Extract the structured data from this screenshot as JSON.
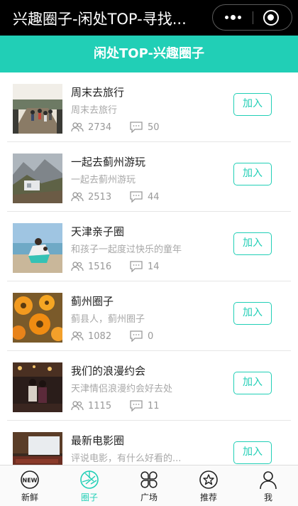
{
  "window": {
    "title": "兴趣圈子-闲处TOP-寻找..."
  },
  "header": {
    "title": "闲处TOP-兴趣圈子"
  },
  "colors": {
    "accent": "#21cfb6",
    "muted": "#a8a8a8"
  },
  "groups": [
    {
      "name": "周末去旅行",
      "desc": "周末去旅行",
      "members": "2734",
      "posts": "50",
      "join_label": "加入"
    },
    {
      "name": "一起去蓟州游玩",
      "desc": "一起去蓟州游玩",
      "members": "2513",
      "posts": "44",
      "join_label": "加入"
    },
    {
      "name": "天津亲子圈",
      "desc": "和孩子一起度过快乐的童年",
      "members": "1516",
      "posts": "14",
      "join_label": "加入"
    },
    {
      "name": "蓟州圈子",
      "desc": "蓟县人，蓟州圈子",
      "members": "1082",
      "posts": "0",
      "join_label": "加入"
    },
    {
      "name": "我们的浪漫约会",
      "desc": "天津情侣浪漫约会好去处",
      "members": "1115",
      "posts": "11",
      "join_label": "加入"
    },
    {
      "name": "最新电影圈",
      "desc": "评说电影，有什么好看的...",
      "members": "",
      "posts": "",
      "join_label": "加入"
    }
  ],
  "tabs": [
    {
      "label": "新鲜",
      "icon": "new-icon"
    },
    {
      "label": "圈子",
      "icon": "camera-aperture-icon",
      "active": true
    },
    {
      "label": "广场",
      "icon": "four-leaf-icon"
    },
    {
      "label": "推荐",
      "icon": "star-circle-icon"
    },
    {
      "label": "我",
      "icon": "person-icon"
    }
  ]
}
